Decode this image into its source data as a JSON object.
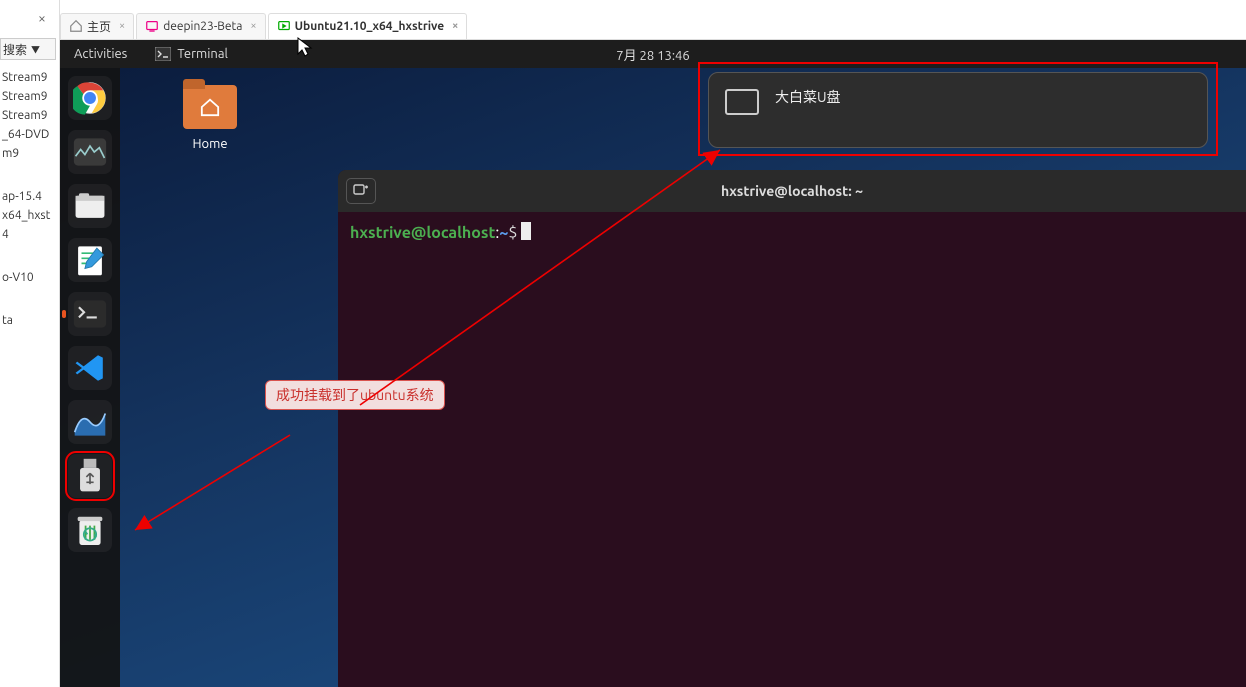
{
  "host": {
    "search_label": "搜索",
    "items": [
      "Stream9",
      "Stream9",
      "Stream9",
      "_64-DVD",
      "m9",
      "",
      "ap-15.4",
      "x64_hxst",
      "4",
      "",
      "o-V10",
      "",
      "ta"
    ]
  },
  "tabs": [
    {
      "label": "主页",
      "icon": "home-icon",
      "active": false
    },
    {
      "label": "deepin23-Beta",
      "icon": "vm-icon",
      "active": false
    },
    {
      "label": "Ubuntu21.10_x64_hxstrive",
      "icon": "vm-run-icon",
      "active": true
    }
  ],
  "topbar": {
    "activities": "Activities",
    "app_label": "Terminal",
    "clock": "7月 28  13:46"
  },
  "desktop": {
    "home_label": "Home"
  },
  "notification": {
    "title": "大白菜U盘"
  },
  "terminal": {
    "window_title": "hxstrive@localhost: ~",
    "prompt_user": "hxstrive@localhost",
    "prompt_sep": ":",
    "prompt_path": "~",
    "prompt_dollar": "$"
  },
  "annotation": {
    "text": "成功挂载到了ubuntu系统"
  },
  "dock": {
    "items": [
      "chrome",
      "monitor",
      "files",
      "editor",
      "terminal",
      "vscode",
      "wireshark",
      "usb",
      "trash"
    ]
  }
}
